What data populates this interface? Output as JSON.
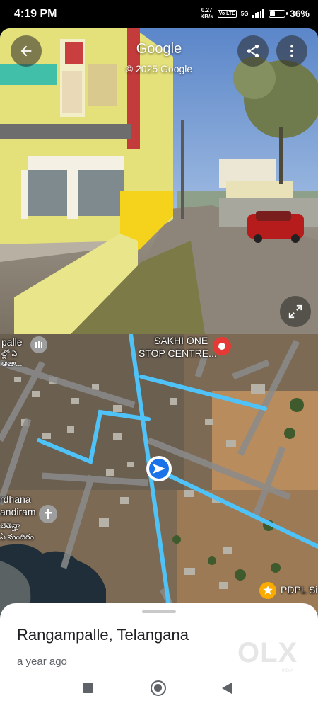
{
  "status_bar": {
    "time": "4:19 PM",
    "net_speed_value": "0.27",
    "net_speed_unit": "KB/s",
    "volte": "Vo LTE",
    "signal": "5G",
    "battery_pct": "36%",
    "battery_level": 0.36
  },
  "street_view": {
    "title": "Google",
    "copyright": "© 2025 Google"
  },
  "map": {
    "labels": {
      "palle": "palle",
      "palle_telugu": "ల్లో ఏ",
      "palle_telugu2": "అజా...",
      "sakhi": "SAKHI ONE",
      "sakhi2": "STOP CENTRE...",
      "rdhana": "rdhana",
      "mandiram": "andiram",
      "mandiram_telugu": "బెతెన్హా",
      "mandiram_telugu2": "ఏ మందిరం",
      "pdpl": "PDPL Si"
    }
  },
  "sheet": {
    "place": "Rangampalle, Telangana",
    "time_ago": "a year ago",
    "watermark": "OLX",
    "watermark_sub": "INDIA"
  },
  "colors": {
    "accent": "#1a73e8",
    "road_blue": "#4fc3f7",
    "pin_red": "#e53935"
  }
}
